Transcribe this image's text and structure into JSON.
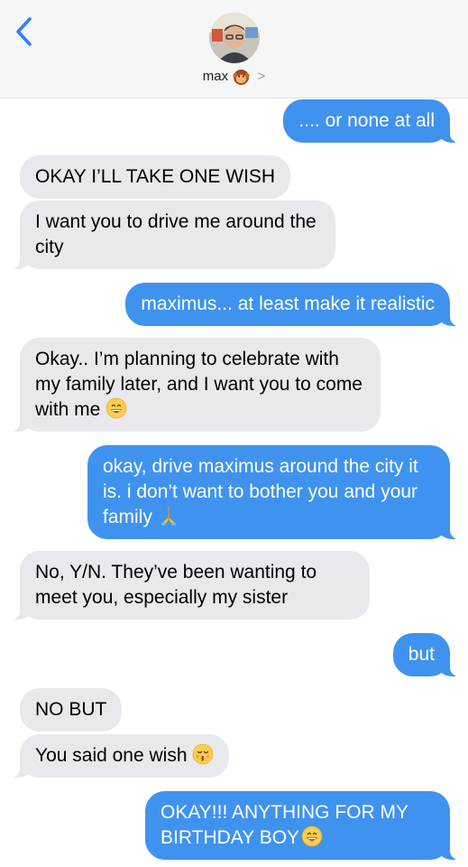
{
  "header": {
    "contact_name": "max",
    "contact_emoji_icon": "monkey-face-icon",
    "chevron": ">"
  },
  "messages": [
    {
      "side": "out",
      "text": ".... or none at all"
    },
    {
      "side": "in",
      "text": "OKAY I’LL TAKE ONE WISH"
    },
    {
      "side": "in",
      "text": "I want you to drive me around the city"
    },
    {
      "side": "out",
      "text": "maximus... at least make it realistic"
    },
    {
      "side": "in",
      "text": "Okay.. I’m planning to celebrate with my family later, and I want you to come with me",
      "emoji": "grinning-face-icon"
    },
    {
      "side": "out",
      "text": "okay, drive maximus around the city it is. i don’t want to bother you and your family",
      "emoji": "folded-hands-icon"
    },
    {
      "side": "in",
      "text": "No, Y/N. They’ve been wanting to meet you, especially my sister"
    },
    {
      "side": "out",
      "text": "but"
    },
    {
      "side": "in",
      "text": "NO BUT"
    },
    {
      "side": "in",
      "text": "You said one wish",
      "emoji": "kissing-face-icon"
    },
    {
      "side": "out",
      "text": "OKAY!!! ANYTHING FOR MY BIRTHDAY BOY",
      "emoji": "grinning-face-icon"
    }
  ],
  "colors": {
    "outgoing_bubble": "#3f93ee",
    "incoming_bubble": "#e8e8ed",
    "back_arrow": "#2f7ff7"
  }
}
